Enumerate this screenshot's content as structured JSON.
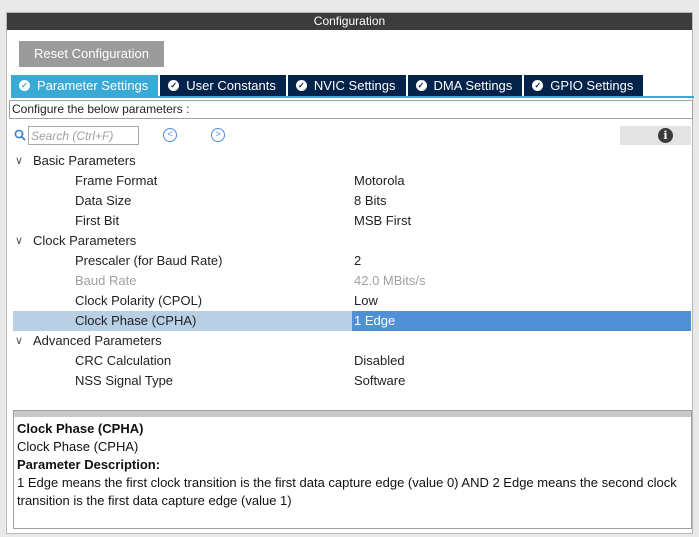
{
  "window": {
    "title": "Configuration"
  },
  "toolbar": {
    "reset_label": "Reset Configuration"
  },
  "tabs": [
    {
      "label": "Parameter Settings",
      "active": true
    },
    {
      "label": "User Constants",
      "active": false
    },
    {
      "label": "NVIC Settings",
      "active": false
    },
    {
      "label": "DMA Settings",
      "active": false
    },
    {
      "label": "GPIO Settings",
      "active": false
    }
  ],
  "configure_text": "Configure the below parameters :",
  "search": {
    "placeholder": "Search (Ctrl+F)"
  },
  "groups": [
    {
      "label": "Basic Parameters",
      "params": [
        {
          "label": "Frame Format",
          "value": "Motorola"
        },
        {
          "label": "Data Size",
          "value": "8 Bits"
        },
        {
          "label": "First Bit",
          "value": "MSB First"
        }
      ]
    },
    {
      "label": "Clock Parameters",
      "params": [
        {
          "label": "Prescaler (for Baud Rate)",
          "value": "2"
        },
        {
          "label": "Baud Rate",
          "value": "42.0 MBits/s",
          "disabled": true
        },
        {
          "label": "Clock Polarity (CPOL)",
          "value": "Low"
        },
        {
          "label": "Clock Phase (CPHA)",
          "value": "1 Edge",
          "selected": true
        }
      ]
    },
    {
      "label": "Advanced Parameters",
      "params": [
        {
          "label": "CRC Calculation",
          "value": "Disabled"
        },
        {
          "label": "NSS Signal Type",
          "value": "Software"
        }
      ]
    }
  ],
  "description": {
    "title": "Clock Phase (CPHA)",
    "subtitle": "Clock Phase (CPHA)",
    "heading": "Parameter Description:",
    "text": "1 Edge means the first clock transition is the first data capture edge (value 0) AND 2 Edge means the second clock transition is the first data capture edge (value 1)"
  },
  "colors": {
    "accent": "#39a9d6",
    "tab_bg": "#03234b",
    "selection": "#b9cfe6",
    "selection_value": "#4f90d6"
  }
}
